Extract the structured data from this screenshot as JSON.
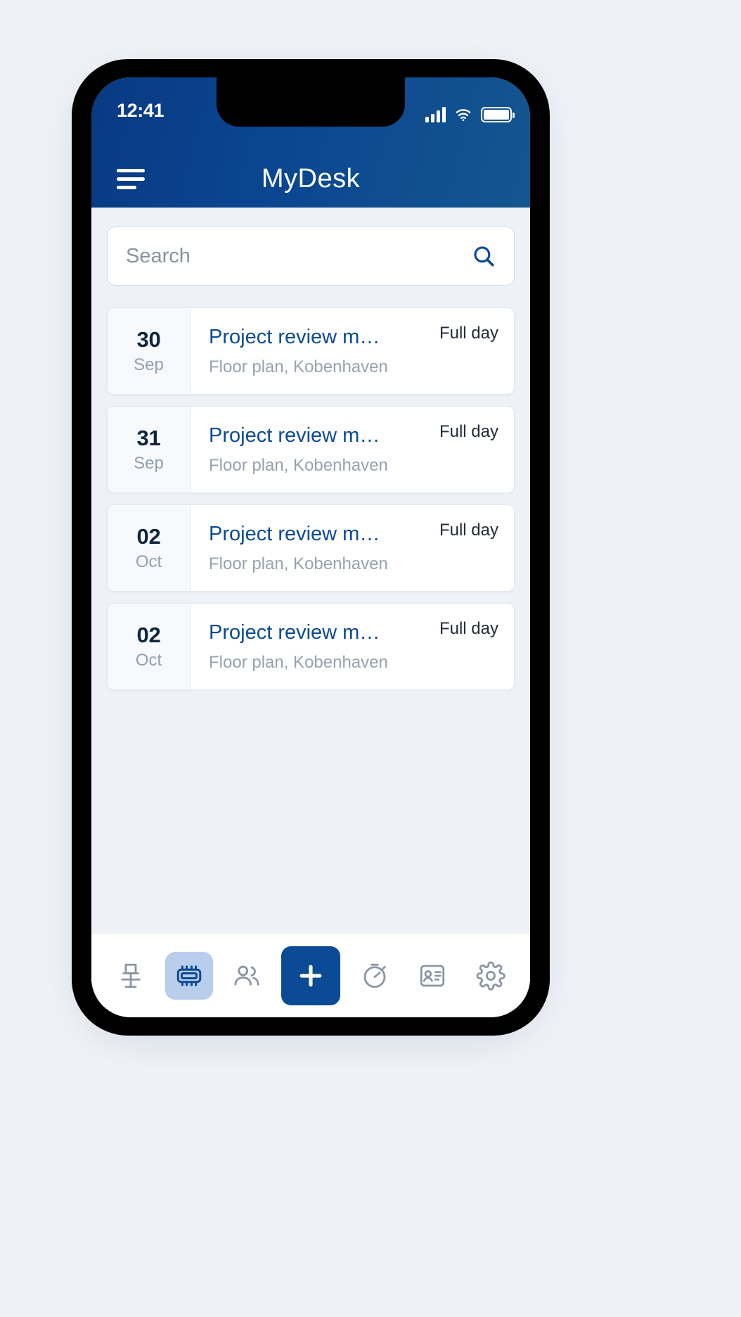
{
  "statusbar": {
    "time": "12:41",
    "signal_icon": "signal-bars-icon",
    "wifi_icon": "wifi-icon",
    "battery_icon": "battery-full-icon"
  },
  "header": {
    "title": "MyDesk",
    "menu_icon": "hamburger-menu-icon",
    "background_start": "#083a82",
    "background_end": "#14568f"
  },
  "search": {
    "value": "",
    "placeholder": "Search",
    "icon": "search-icon"
  },
  "bookings": [
    {
      "day": "30",
      "month": "Sep",
      "title": "Project review m…",
      "location": "Floor plan, Kobenhaven",
      "duration": "Full day"
    },
    {
      "day": "31",
      "month": "Sep",
      "title": "Project review m…",
      "location": "Floor plan, Kobenhaven",
      "duration": "Full day"
    },
    {
      "day": "02",
      "month": "Oct",
      "title": "Project review m…",
      "location": "Floor plan, Kobenhaven",
      "duration": "Full day"
    },
    {
      "day": "02",
      "month": "Oct",
      "title": "Project review m…",
      "location": "Floor plan, Kobenhaven",
      "duration": "Full day"
    }
  ],
  "bottom_nav": {
    "accent_color": "#0b4a95",
    "active_pill_color": "#b9cdec",
    "items": [
      {
        "icon": "office-chair-icon",
        "active": false
      },
      {
        "icon": "meeting-room-icon",
        "active": true
      },
      {
        "icon": "people-icon",
        "active": false
      },
      {
        "icon": "plus-icon",
        "active": false
      },
      {
        "icon": "stopwatch-icon",
        "active": false
      },
      {
        "icon": "id-badge-icon",
        "active": false
      },
      {
        "icon": "settings-gear-icon",
        "active": false
      }
    ]
  }
}
